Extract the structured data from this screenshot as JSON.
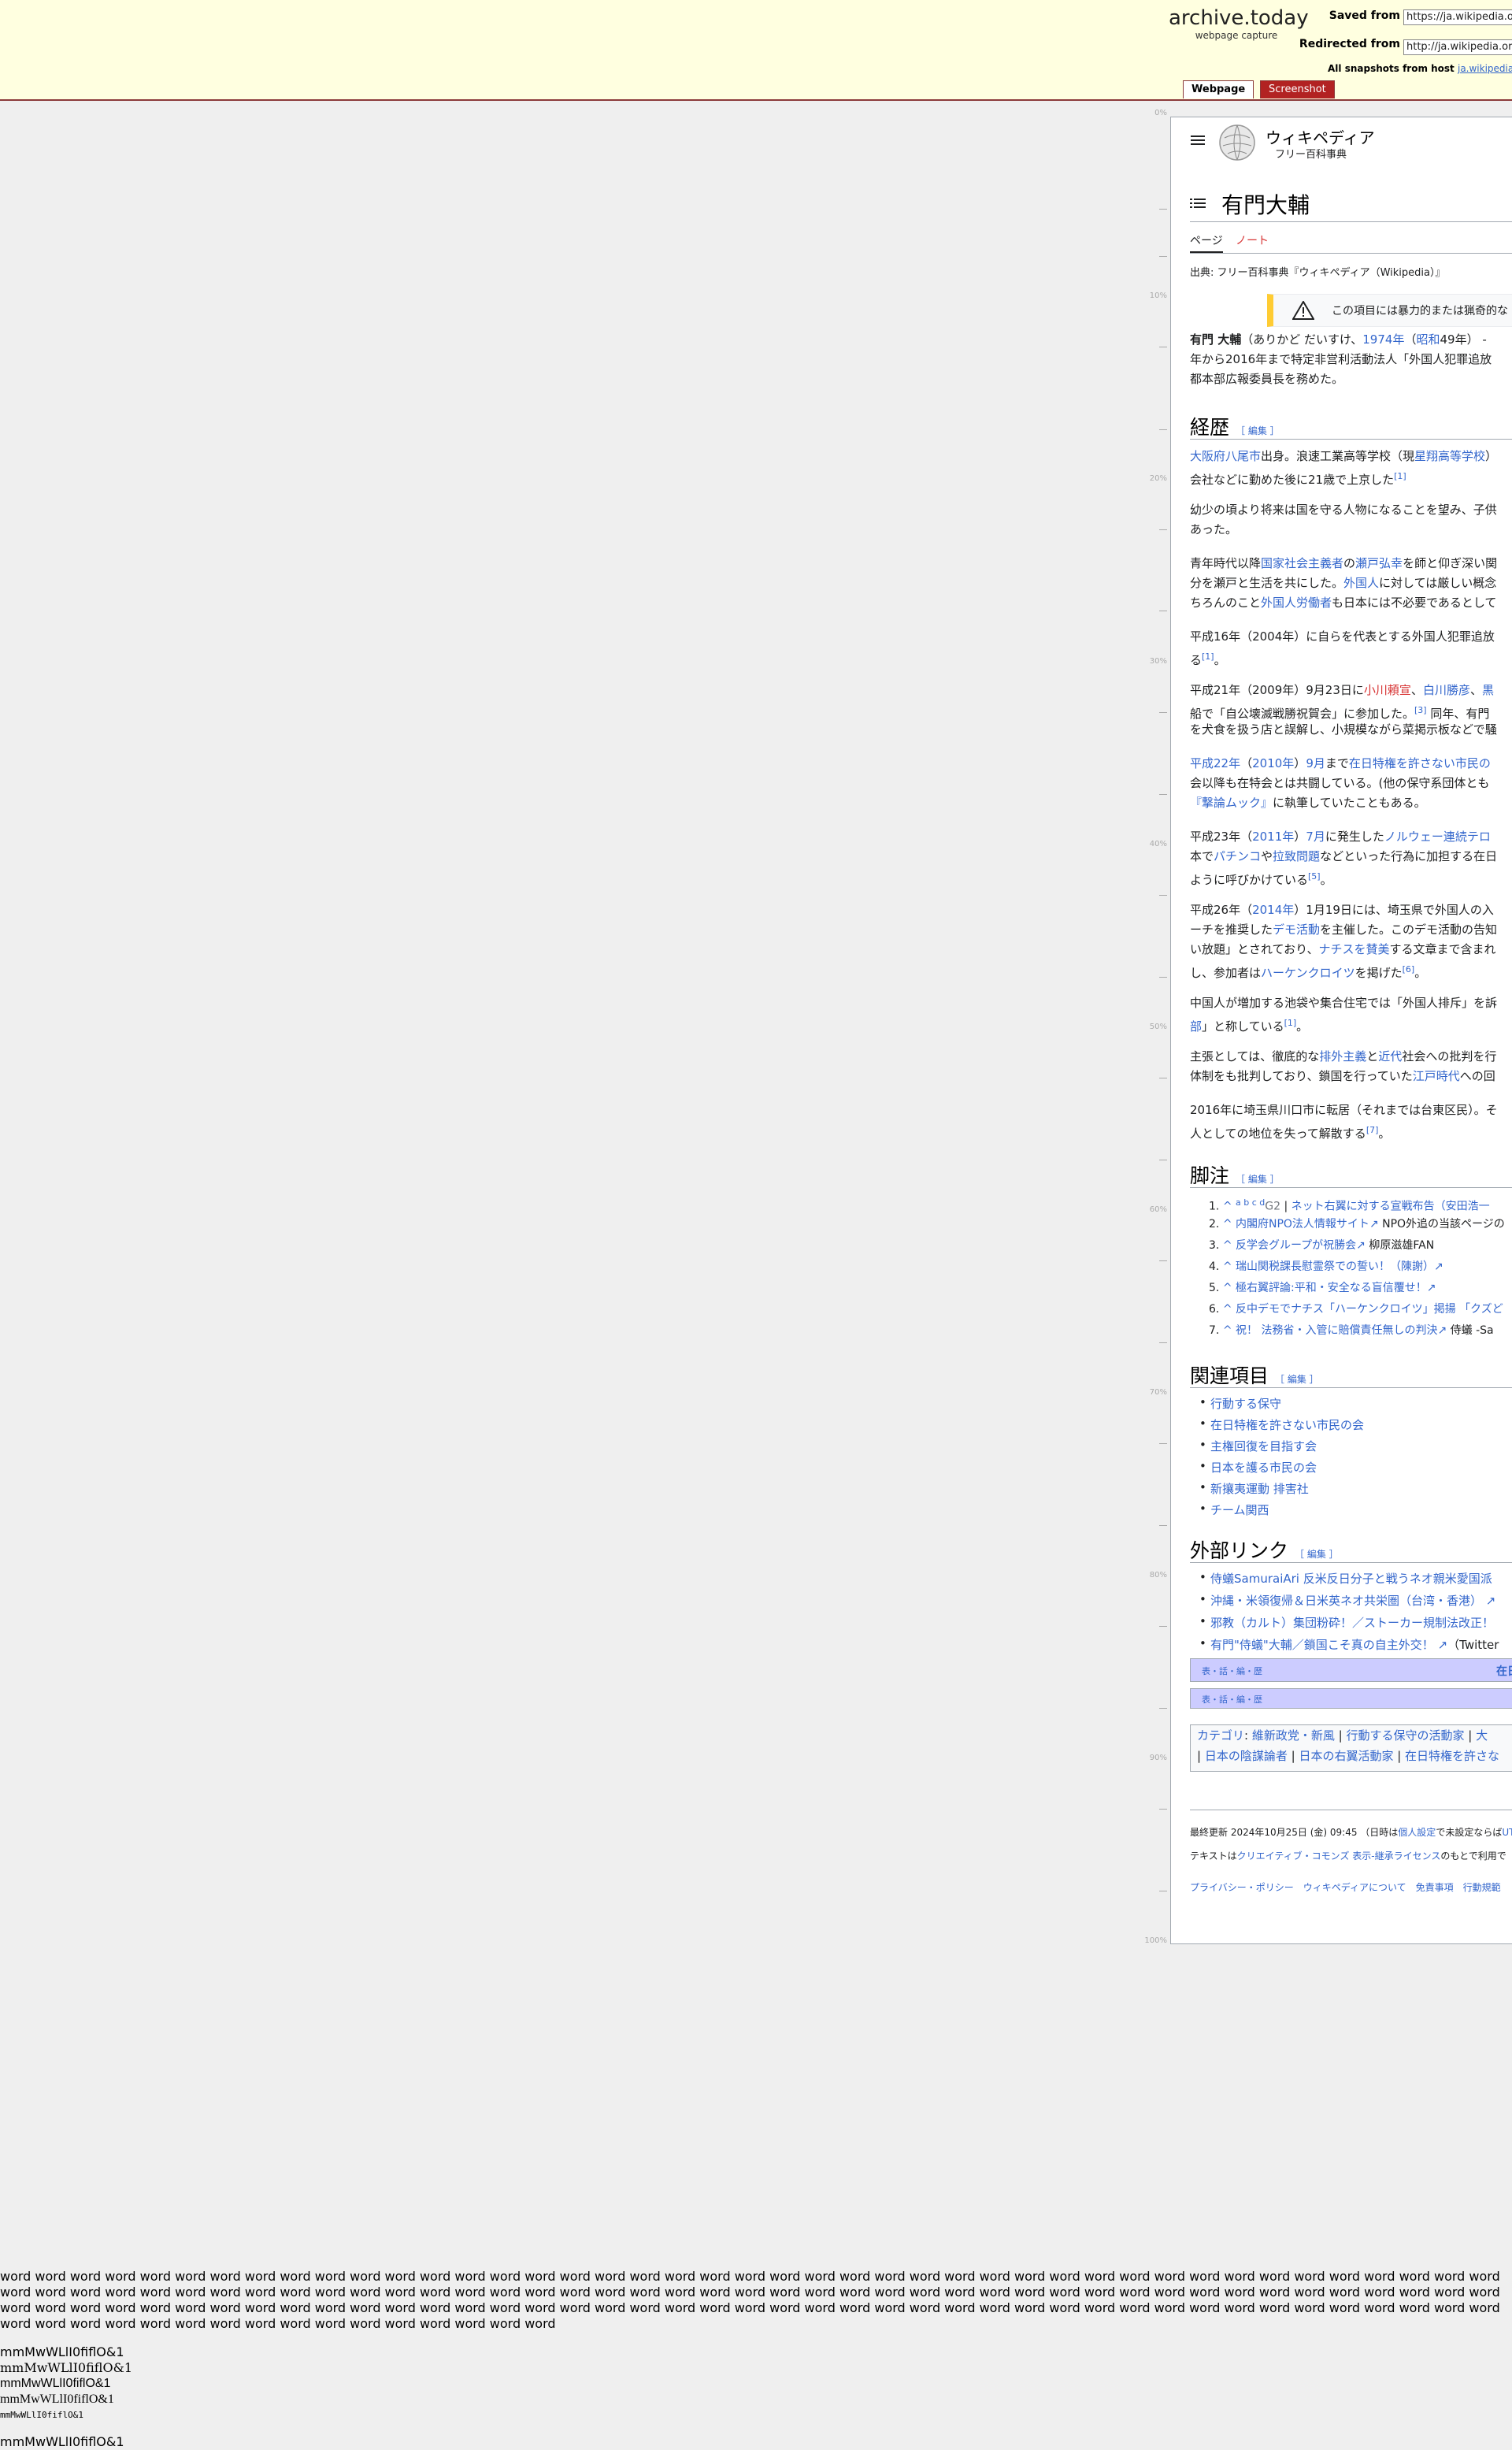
{
  "archive": {
    "logo": "archive.today",
    "tagline": "webpage capture",
    "saved_from_label": "Saved from",
    "saved_from_value": "https://ja.wikipedia.org/",
    "redirected_from_label": "Redirected from",
    "redirected_from_value": "http://ja.wikipedia.org/",
    "all_snapshots_label": "All snapshots",
    "from_host_label": "from host",
    "host_value": "ja.wikipedia.org",
    "tab_webpage": "Webpage",
    "tab_screenshot": "Screenshot",
    "accent_color": "#b22222",
    "header_bg": "#ffffe0"
  },
  "ruler": [
    "0%",
    "10%",
    "20%",
    "30%",
    "40%",
    "50%",
    "60%",
    "70%",
    "80%",
    "90%",
    "100%"
  ],
  "wiki": {
    "menu_icon": "hamburger-icon",
    "brand_title": "ウィキペディア",
    "brand_subtitle": "フリー百科事典",
    "toc_icon": "list-icon",
    "page_title": "有門大輔",
    "tab_page": "ページ",
    "tab_talk": "ノート",
    "from_line": "出典: フリー百科事典『ウィキペディア（Wikipedia）』",
    "warning_text": "この項目には暴力的または猟奇的な",
    "intro": {
      "l1_bold": "有門 大輔",
      "l1_a": "（ありかど だいすけ、",
      "l1_link1": "1974年",
      "l1_b": "（",
      "l1_link2": "昭和",
      "l1_c": "49年） -",
      "l2": "年から2016年まで特定非営利活動法人「外国人犯罪追放",
      "l3": "都本部広報委員長を務めた。"
    },
    "edit_label": "［ 編集 ］",
    "sections": {
      "history": "経歴",
      "notes": "脚注",
      "related": "関連項目",
      "external": "外部リンク"
    },
    "history": {
      "p1_l1_link": "大阪府八尾市",
      "p1_l1_a": "出身。浪速工業高等学校（現",
      "p1_l1_link2": "星翔高等学校",
      "p1_l1_b": "）",
      "p1_l2": "会社などに勤めた後に21歳で上京した",
      "p1_ref": "[1]",
      "p2_l1": "幼少の頃より将来は国を守る人物になることを望み、子供",
      "p2_l2": "あった。",
      "p3_l1_a": "青年時代以降",
      "p3_l1_link1": "国家社会主義者",
      "p3_l1_b": "の",
      "p3_l1_link2": "瀬戸弘幸",
      "p3_l1_c": "を師と仰ぎ深い関",
      "p3_l2_a": "分を瀬戸と生活を共にした。",
      "p3_l2_link": "外国人",
      "p3_l2_b": "に対しては厳しい概念",
      "p3_l3_a": "ちろんのこと",
      "p3_l3_link": "外国人労働者",
      "p3_l3_b": "も日本には不必要であるとして",
      "p4_l1": "平成16年（2004年）に自らを代表とする外国人犯罪追放",
      "p4_l2_a": "る",
      "p4_ref": "[1]",
      "p4_l2_b": "。",
      "p5_l1_a": "平成21年（2009年）9月23日に",
      "p5_l1_link1": "小川頼宣",
      "p5_l1_b": "、",
      "p5_l1_link2": "白川勝彦",
      "p5_l1_c": "、",
      "p5_l1_link3": "黒",
      "p5_l2_a": "船で「自公壊滅戦勝祝賀会」に参加した。",
      "p5_ref": "[3]",
      "p5_l2_b": " 同年、有門",
      "p5_l3": "を犬食を扱う店と誤解し、小規模ながら菜掲示板などで騒",
      "p6_l1_link1": "平成22年",
      "p6_l1_a": "（",
      "p6_l1_link2": "2010年",
      "p6_l1_b": "）",
      "p6_l1_link3": "9月",
      "p6_l1_c": "まで",
      "p6_l1_link4": "在日特権を許さない市民の",
      "p6_l2": "会以降も在特会とは共闘している。(他の保守系団体とも",
      "p6_l3_link": "『撃論ムック』",
      "p6_l3_a": "に執筆していたこともある。",
      "p7_l1_a": "平成23年（",
      "p7_l1_link1": "2011年",
      "p7_l1_b": "）",
      "p7_l1_link2": "7月",
      "p7_l1_c": "に発生した",
      "p7_l1_link3": "ノルウェー連続テロ",
      "p7_l2_a": "本で",
      "p7_l2_link1": "パチンコ",
      "p7_l2_b": "や",
      "p7_l2_link2": "拉致問題",
      "p7_l2_c": "などといった行為に加担する在日",
      "p7_l3_a": "ように呼びかけている",
      "p7_ref": "[5]",
      "p7_l3_b": "。",
      "p8_l1_a": "平成26年（",
      "p8_l1_link": "2014年",
      "p8_l1_b": "）1月19日には、埼玉県で外国人の入",
      "p8_l2_a": "ーチを推奨した",
      "p8_l2_link": "デモ活動",
      "p8_l2_b": "を主催した。このデモ活動の告知",
      "p8_l3_a": "い放題」とされており、",
      "p8_l3_link": "ナチスを賛美",
      "p8_l3_b": "する文章まで含まれ",
      "p8_l4_a": "し、参加者は",
      "p8_l4_link": "ハーケンクロイツ",
      "p8_l4_b": "を掲げた",
      "p8_ref": "[6]",
      "p8_l4_c": "。",
      "p9_l1": "中国人が増加する池袋や集合住宅では「外国人排斥」を訴",
      "p9_l2_link": "部",
      "p9_l2_a": "」と称している",
      "p9_ref": "[1]",
      "p9_l2_b": "。",
      "p10_l1_a": "主張としては、徹底的な",
      "p10_l1_link1": "排外主義",
      "p10_l1_b": "と",
      "p10_l1_link2": "近代",
      "p10_l1_c": "社会への批判を行",
      "p10_l2_a": "体制をも批判しており、鎖国を行っていた",
      "p10_l2_link": "江戸時代",
      "p10_l2_b": "への回",
      "p11_l1": "2016年に埼玉県川口市に転居（それまでは台東区民）。そ",
      "p11_l2_a": "人としての地位を失って解散する",
      "p11_ref": "[7]",
      "p11_l2_b": "。"
    },
    "notes": [
      {
        "n": "1.",
        "caret": "^",
        "back": "a b c d",
        "src": "G2",
        "title": "ネット右翼に対する宣戦布告（安田浩一"
      },
      {
        "n": "2.",
        "caret": "^",
        "back": "",
        "src": "",
        "title": "内閣府NPO法人情報サイト",
        "tail": " NPO外追の当該ページの"
      },
      {
        "n": "3.",
        "caret": "^",
        "back": "",
        "src": "",
        "title": "反学会グループが祝勝会",
        "tail": " 柳原滋雄FAN"
      },
      {
        "n": "4.",
        "caret": "^",
        "back": "",
        "src": "",
        "title": "瑞山関税課長慰霊祭での誓い！（陳謝）",
        "tail": ""
      },
      {
        "n": "5.",
        "caret": "^",
        "back": "",
        "src": "",
        "title": "極右翼評論:平和・安全なる盲信覆せ！",
        "tail": ""
      },
      {
        "n": "6.",
        "caret": "^",
        "back": "",
        "src": "",
        "title": "反中デモでナチス「ハーケンクロイツ」掲揚 「クズど",
        "tail": ""
      },
      {
        "n": "7.",
        "caret": "^",
        "back": "",
        "src": "",
        "title": "祝！ 法務省・入管に賠償責任無しの判決",
        "tail": " 侍蟻 -Sa"
      }
    ],
    "related": [
      "行動する保守",
      "在日特権を許さない市民の会",
      "主権回復を目指す会",
      "日本を護る市民の会",
      "新攘夷運動 排害社",
      "チーム関西"
    ],
    "external": [
      {
        "text": "侍蟻SamuraiAri 反米反日分子と戦うネオ親米愛国派",
        "tail": ""
      },
      {
        "text": "沖縄・米領復帰＆日米英ネオ共栄圏（台湾・香港）",
        "tail": ""
      },
      {
        "text": "邪教（カルト）集団粉砕！／ストーカー規制法改正！",
        "tail": ""
      },
      {
        "text": "有門\"侍蟻\"大輔／鎖国こそ真の自主外交！",
        "tail": "（Twitter"
      }
    ],
    "navbox1_vte": "表・話・編・歴",
    "navbox1_title": "在日",
    "navbox2_vte": "表・話・編・歴",
    "categories_label": "カテゴリ",
    "categories_l1": [
      "維新政党・新風",
      "行動する保守の活動家",
      "大"
    ],
    "categories_l2": [
      "日本の陰謀論者",
      "日本の右翼活動家",
      "在日特権を許さな"
    ],
    "footer": {
      "last_edit": "最終更新 2024年10月25日 (金) 09:45 （日時は",
      "last_edit_link": "個人設定",
      "last_edit_tail": "で未設定ならば",
      "last_edit_tail2": "UT",
      "license_a": "テキストは",
      "license_link": "クリエイティブ・コモンズ 表示-継承ライセンス",
      "license_b": "のもとで利用で",
      "links": [
        "プライバシー・ポリシー",
        "ウィキペディアについて",
        "免責事項",
        "行動規範"
      ]
    }
  },
  "bottom": {
    "words": "word word word word word word word word word word word word word word word word word word word word word word word word word word word word word word word word word word word word word word word word word word word word word word word word word word word word word word word word word word word word word word word word word word word word word word word word word word word word word word word word word word word word word word word word word word word word word word word word word word word word word word word word word word word word word word word word word word word word word word word word word word word word word word word word word word word word word word word word word word word word word word word word word",
    "mm": [
      "mmMwWLlI0fiflO&1",
      "mmMwWLlI0fiflO&1",
      "mmMwWLlI0fiflO&1",
      "mmMwWLlI0fiflO&1",
      "mmMwWLlI0fiflO&1",
      "mmMwWLlI0fiflO&1"
    ]
  }
}
